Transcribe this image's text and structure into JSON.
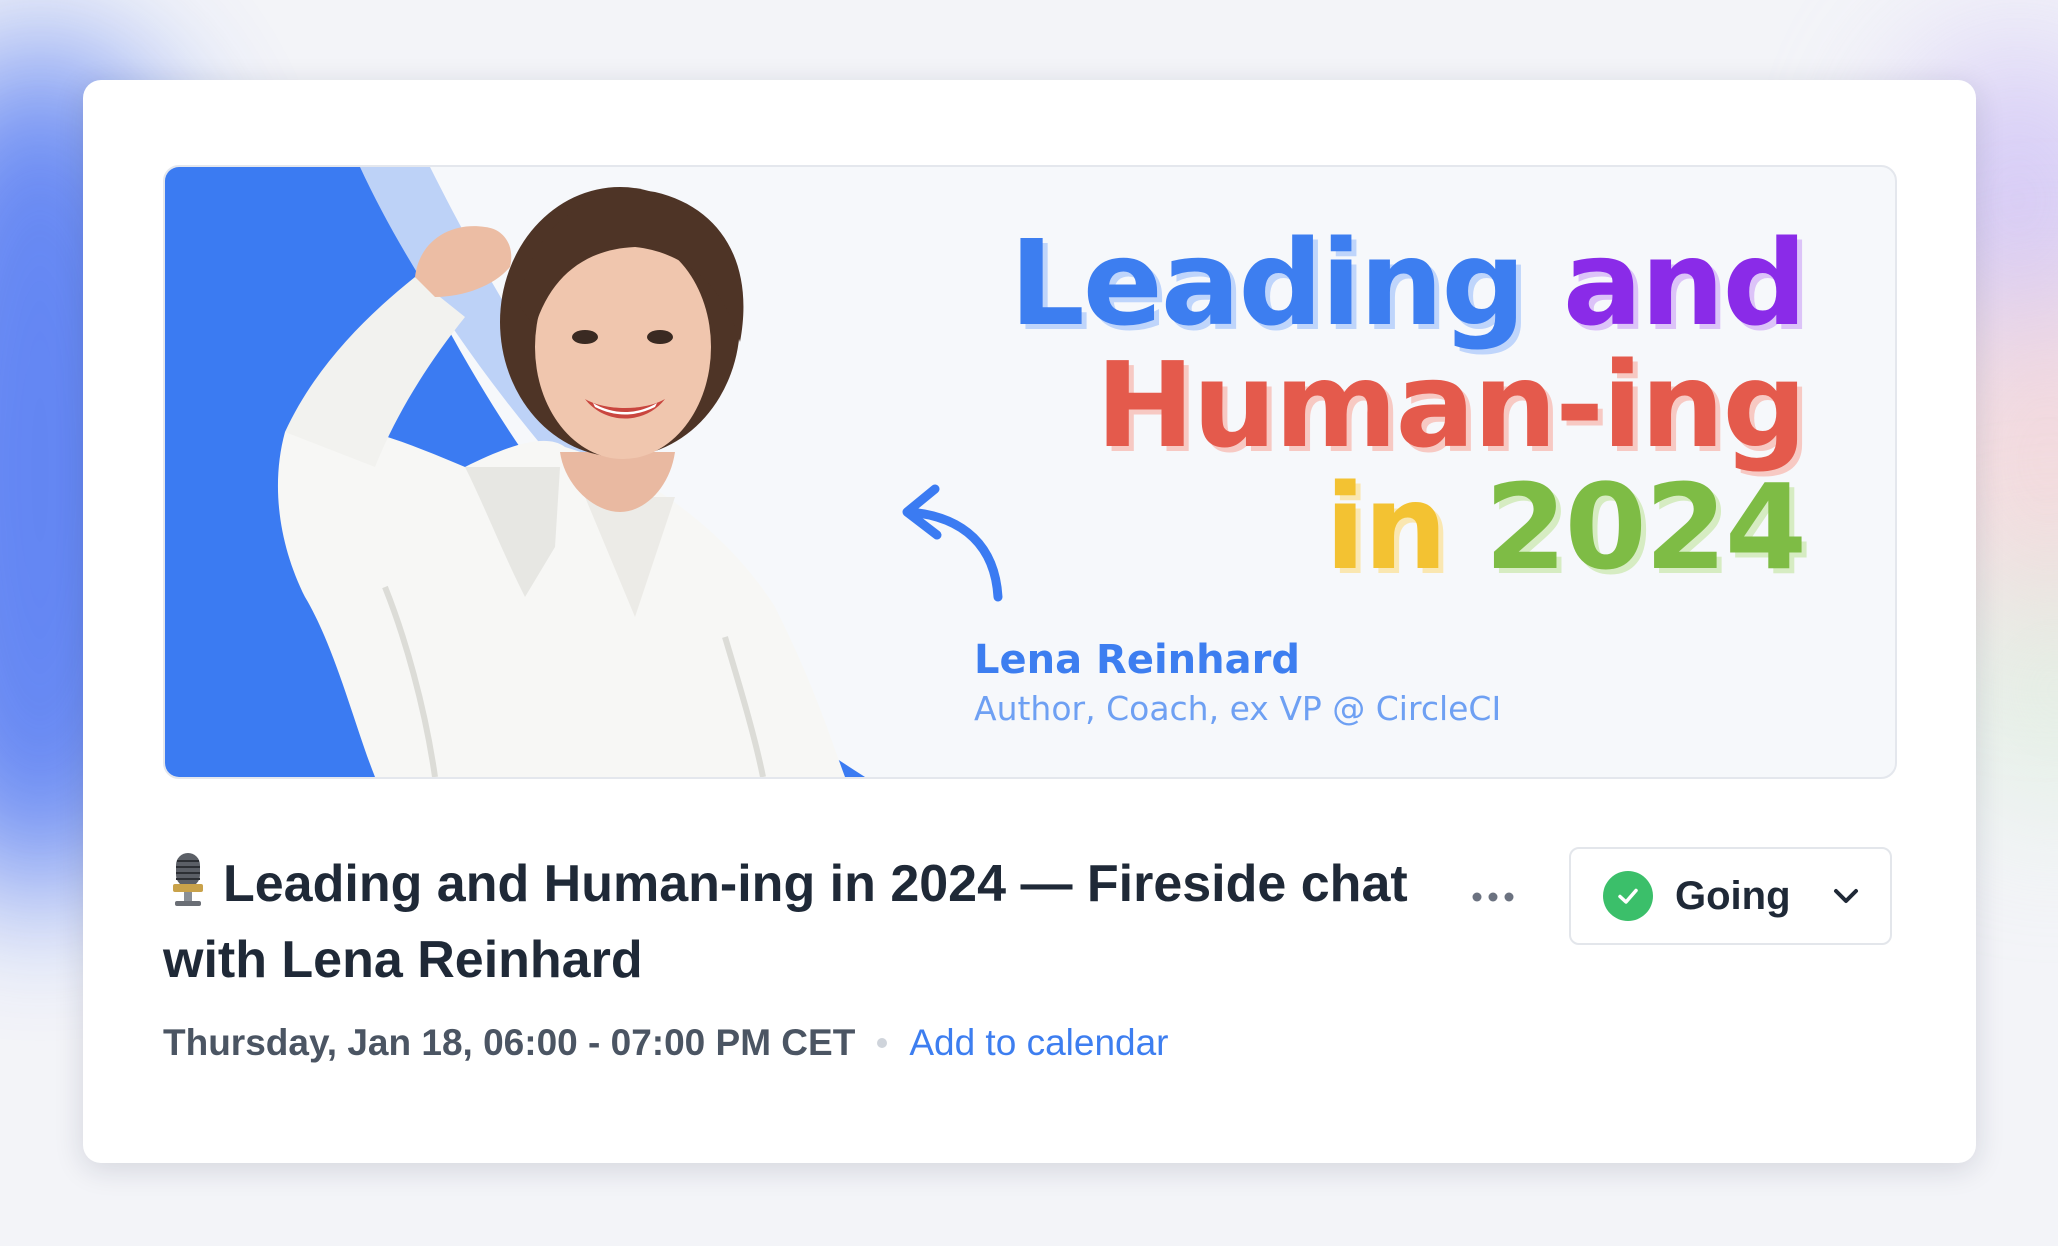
{
  "banner": {
    "title_words": {
      "leading": "Leading",
      "and": "and",
      "human": "Human-ing",
      "in": "in",
      "year": "2024"
    },
    "speaker_name": "Lena Reinhard",
    "speaker_role": "Author, Coach, ex VP @ CircleCI"
  },
  "event": {
    "icon": "microphone-icon",
    "title": "Leading and Human-ing in 2024 — Fireside chat with Lena Reinhard",
    "more_icon": "more-horizontal-icon",
    "rsvp": {
      "status": "Going",
      "status_icon": "check-circle-icon",
      "dropdown_icon": "chevron-down-icon",
      "status_color": "#3bbf6a"
    },
    "datetime": "Thursday, Jan 18, 06:00 - 07:00 PM CET",
    "calendar_link": "Add to calendar"
  },
  "colors": {
    "accent": "#3d7ef0",
    "purple": "#8a2be8",
    "red": "#e45a4c",
    "yellow": "#f3c232",
    "green": "#7ebc45"
  }
}
